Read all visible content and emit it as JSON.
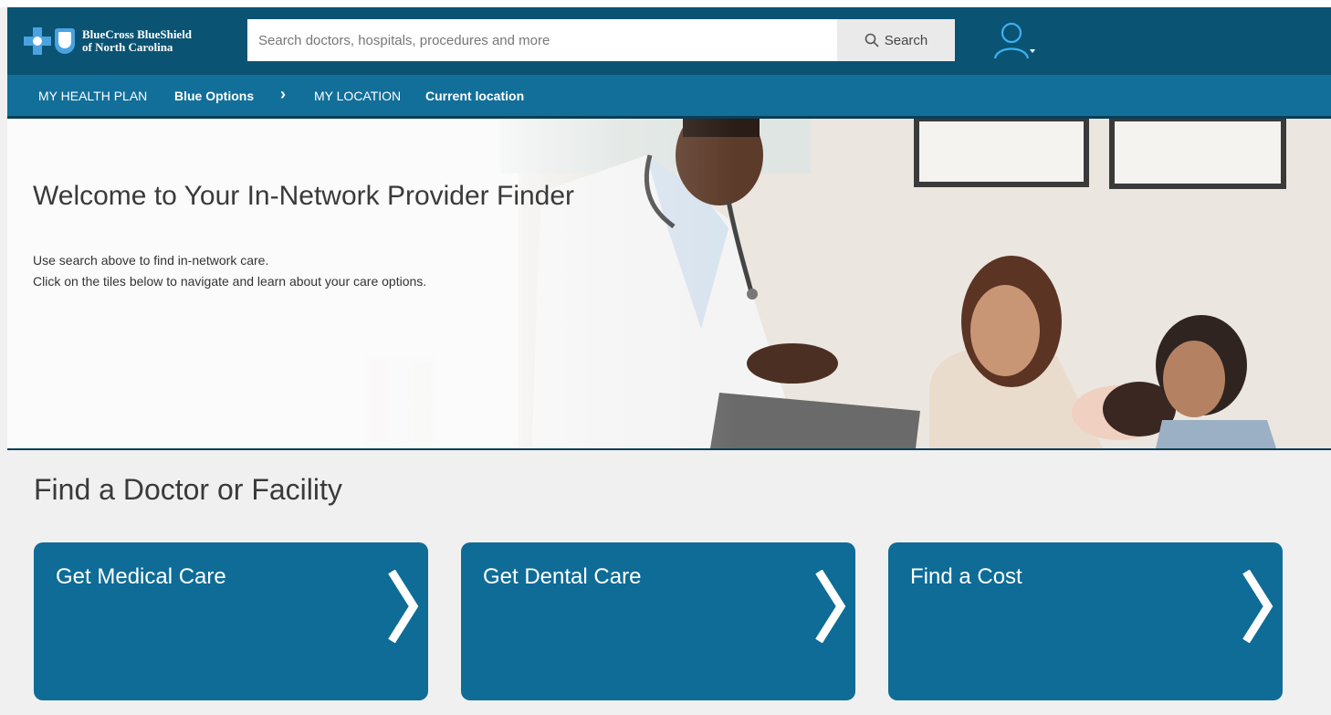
{
  "header": {
    "logo_line1": "BlueCross BlueShield",
    "logo_line2": "of North Carolina",
    "search_placeholder": "Search doctors, hospitals, procedures and more",
    "search_button_label": "Search",
    "search_icon": "search-icon",
    "user_icon": "user-icon"
  },
  "nav": {
    "plan_label": "MY HEALTH PLAN",
    "plan_value": "Blue Options",
    "separator": "›",
    "location_label": "MY LOCATION",
    "location_value": "Current location"
  },
  "hero": {
    "title": "Welcome to Your In-Network Provider Finder",
    "line1": "Use search above to find in-network care.",
    "line2": "Click on the tiles below to navigate and learn about your care options."
  },
  "section": {
    "heading": "Find a Doctor or Facility",
    "tiles": [
      {
        "label": "Get Medical Care"
      },
      {
        "label": "Get Dental Care"
      },
      {
        "label": "Find a Cost"
      }
    ]
  },
  "colors": {
    "header_bg": "#0a5373",
    "nav_bg": "#126f9a",
    "tile_bg": "#0e6c97",
    "page_bg": "#f0f0f0"
  }
}
